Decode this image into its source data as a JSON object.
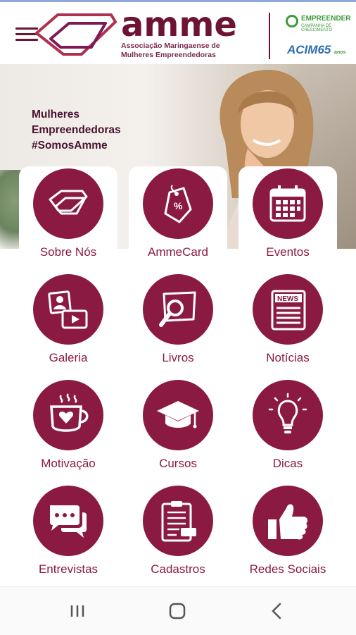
{
  "header": {
    "brand": "amme",
    "subtitle_line1": "Associação Maringaense de",
    "subtitle_line2": "Mulheres Empreendedoras",
    "partner1_name": "EMPREENDER",
    "partner1_tag": "CAMPANHA DE CRESCIMENTO",
    "partner2_name": "ACIM65",
    "partner2_tag": "anos"
  },
  "hero": {
    "line1": "Mulheres",
    "line2": "Empreendedoras",
    "line3": "#SomosAmme"
  },
  "menu_items": [
    {
      "label": "Sobre Nós",
      "icon": "cards-icon"
    },
    {
      "label": "AmmeCard",
      "icon": "discount-tag-icon"
    },
    {
      "label": "Eventos",
      "icon": "calendar-icon"
    },
    {
      "label": "Galeria",
      "icon": "gallery-icon"
    },
    {
      "label": "Livros",
      "icon": "book-search-icon"
    },
    {
      "label": "Notícias",
      "icon": "newspaper-icon"
    },
    {
      "label": "Motivação",
      "icon": "heart-cup-icon"
    },
    {
      "label": "Cursos",
      "icon": "graduation-cap-icon"
    },
    {
      "label": "Dicas",
      "icon": "lightbulb-icon"
    },
    {
      "label": "Entrevistas",
      "icon": "chat-bubbles-icon"
    },
    {
      "label": "Cadastros",
      "icon": "clipboard-icon"
    },
    {
      "label": "Redes Sociais",
      "icon": "thumbs-up-icon"
    }
  ],
  "newspaper_icon_text": "NEWS",
  "colors": {
    "accent": "#8b1a42",
    "brand": "#6d1434"
  }
}
